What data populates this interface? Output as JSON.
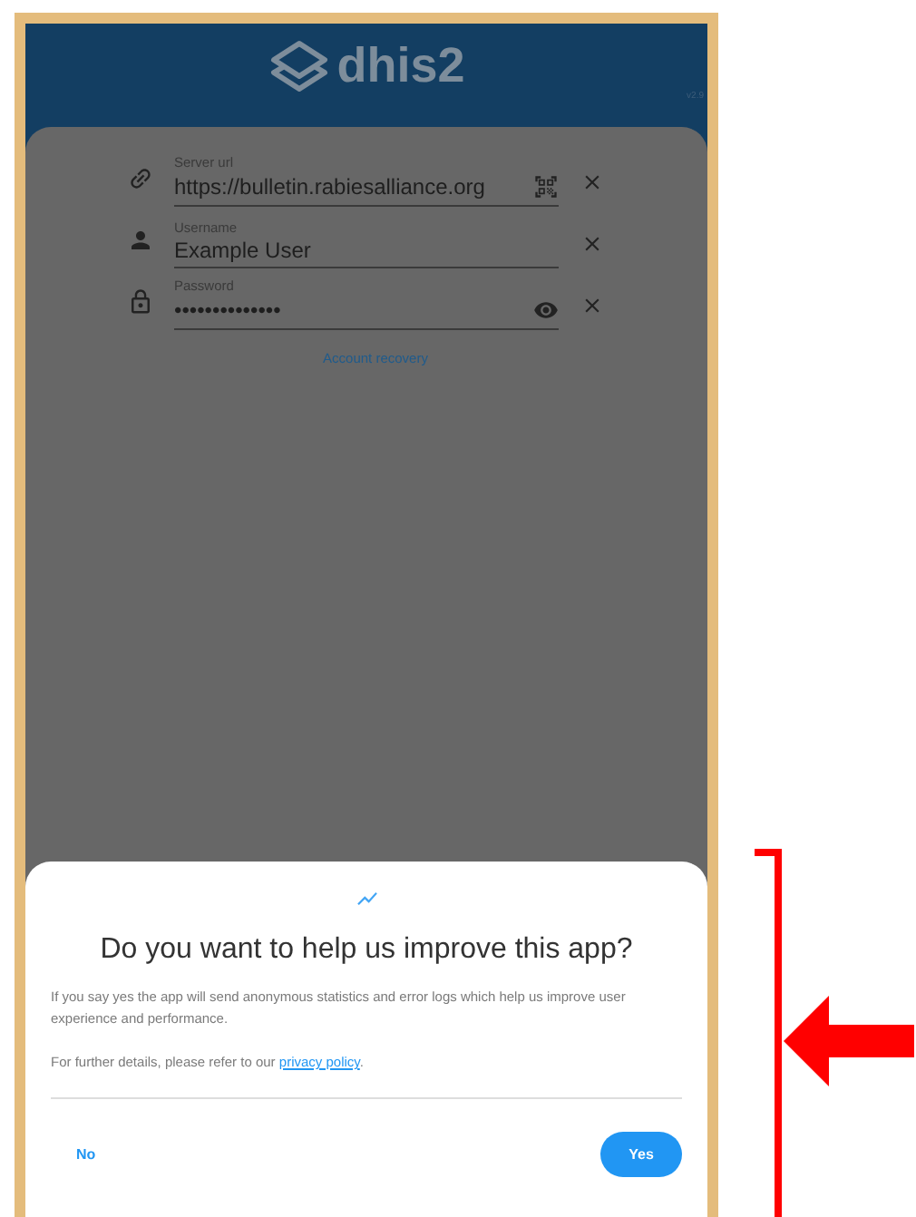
{
  "header": {
    "logo_text": "dhis2",
    "version": "v2.9"
  },
  "form": {
    "fields": [
      {
        "kind": "url",
        "label": "Server url",
        "value": "https://bulletin.rabiesalliance.org"
      },
      {
        "kind": "user",
        "label": "Username",
        "value": "Example User"
      },
      {
        "kind": "password",
        "label": "Password",
        "value": "••••••••••••••"
      }
    ],
    "account_recovery": "Account recovery"
  },
  "dialog": {
    "title": "Do you want to help us improve this app?",
    "body": "If you say yes the app will send anonymous statistics and error logs which help us improve user experience and performance.",
    "details_prefix": "For further details, please refer to our ",
    "details_link": "privacy policy",
    "details_suffix": ".",
    "buttons": {
      "no": "No",
      "yes": "Yes"
    }
  }
}
